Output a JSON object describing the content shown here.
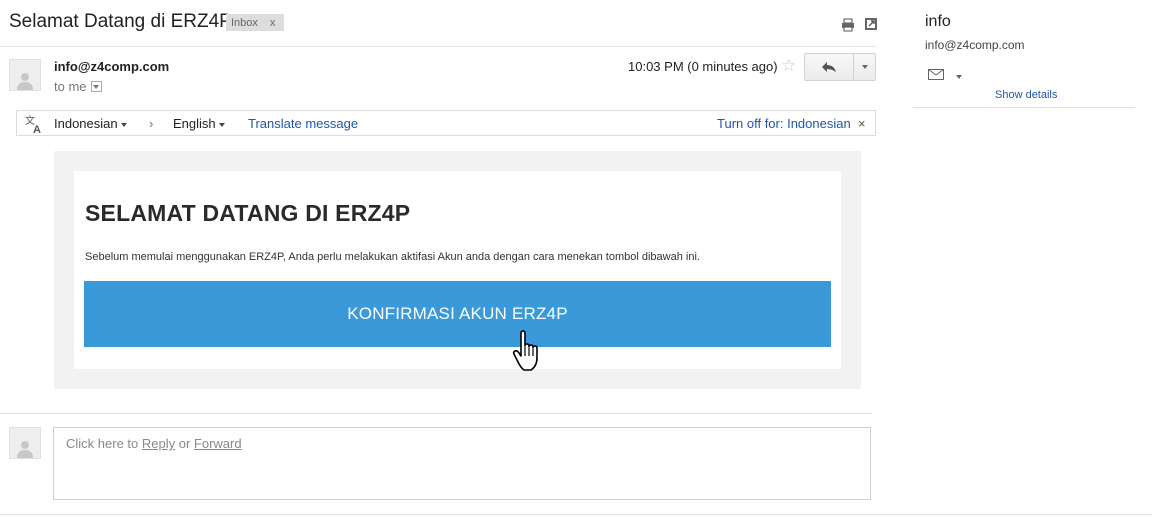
{
  "header": {
    "subject": "Selamat Datang di ERZ4P",
    "label": "Inbox",
    "label_remove": "x",
    "icons": [
      "print-icon",
      "popout-icon"
    ]
  },
  "message": {
    "sender_email": "info@z4comp.com",
    "to_text": "to me",
    "time": "10:03 PM (0 minutes ago)",
    "star": "☆"
  },
  "translate_bar": {
    "from_lang": "Indonesian",
    "separator": "›",
    "to_lang": "English",
    "translate_link": "Translate message",
    "turn_off": "Turn off for: Indonesian",
    "close": "×"
  },
  "email_body": {
    "title": "SELAMAT DATANG DI ERZ4P",
    "text": "Sebelum memulai menggunakan ERZ4P, Anda perlu melakukan aktifasi Akun anda dengan cara menekan tombol dibawah ini.",
    "button_label": "KONFIRMASI AKUN ERZ4P",
    "button_color": "#3a9ad9"
  },
  "reply_box": {
    "prefix": "Click here to ",
    "reply": "Reply",
    "middle": " or ",
    "forward": "Forward"
  },
  "right_pane": {
    "name": "info",
    "email": "info@z4comp.com",
    "show_details": "Show details"
  }
}
